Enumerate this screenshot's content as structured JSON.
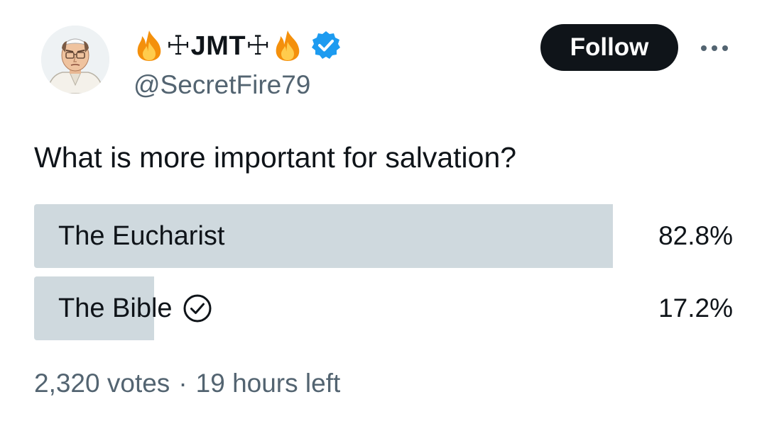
{
  "tweet": {
    "author": {
      "display_name": "☩JMT☩",
      "handle": "@SecretFire79",
      "verified": true,
      "avatar_icon": "pope-avatar-icon",
      "flame_icon": "fire-emoji-icon"
    },
    "follow_label": "Follow",
    "more_icon": "more-horizontal-icon",
    "question": "What is more important for salvation?",
    "poll": {
      "options": [
        {
          "label": "The Eucharist",
          "percent_text": "82.8%",
          "percent": 82.8,
          "selected": false
        },
        {
          "label": "The Bible",
          "percent_text": "17.2%",
          "percent": 17.2,
          "selected": true
        }
      ],
      "votes": "2,320 votes",
      "separator": "·",
      "time_left": "19 hours left"
    }
  },
  "colors": {
    "text_primary": "#0f1419",
    "text_secondary": "#536471",
    "poll_bar": "#cfd9de",
    "verified_blue": "#1d9bf0",
    "follow_bg": "#0f1419"
  }
}
